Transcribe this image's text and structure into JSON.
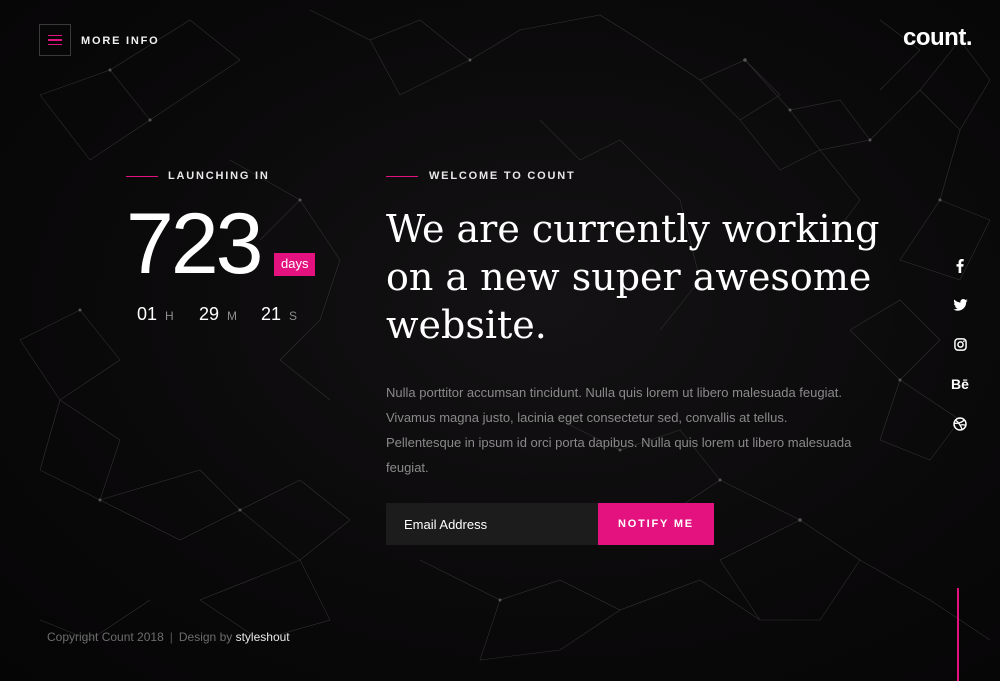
{
  "header": {
    "menu_label": "MORE INFO",
    "logo_text": "count."
  },
  "countdown": {
    "label": "LAUNCHING IN",
    "days": "723",
    "days_unit": "days",
    "hours": "01",
    "hours_unit": "H",
    "minutes": "29",
    "minutes_unit": "M",
    "seconds": "21",
    "seconds_unit": "S"
  },
  "intro": {
    "label": "WELCOME TO COUNT",
    "headline": "We are currently working on a new super awesome website.",
    "description": "Nulla porttitor accumsan tincidunt. Nulla quis lorem ut libero malesuada feugiat. Vivamus magna justo, lacinia eget consectetur sed, convallis at tellus. Pellentesque in ipsum id orci porta dapibus. Nulla quis lorem ut libero malesuada feugiat."
  },
  "subscribe": {
    "placeholder": "Email Address",
    "button_label": "NOTIFY ME"
  },
  "social": {
    "items": [
      "facebook-icon",
      "twitter-icon",
      "instagram-icon",
      "behance-icon",
      "dribbble-icon"
    ],
    "behance_text": "Bē"
  },
  "footer": {
    "copyright": "Copyright Count 2018",
    "separator": "|",
    "design_by": "Design by",
    "author": "styleshout"
  },
  "colors": {
    "accent": "#e3127f",
    "background": "#0b0a0b"
  }
}
